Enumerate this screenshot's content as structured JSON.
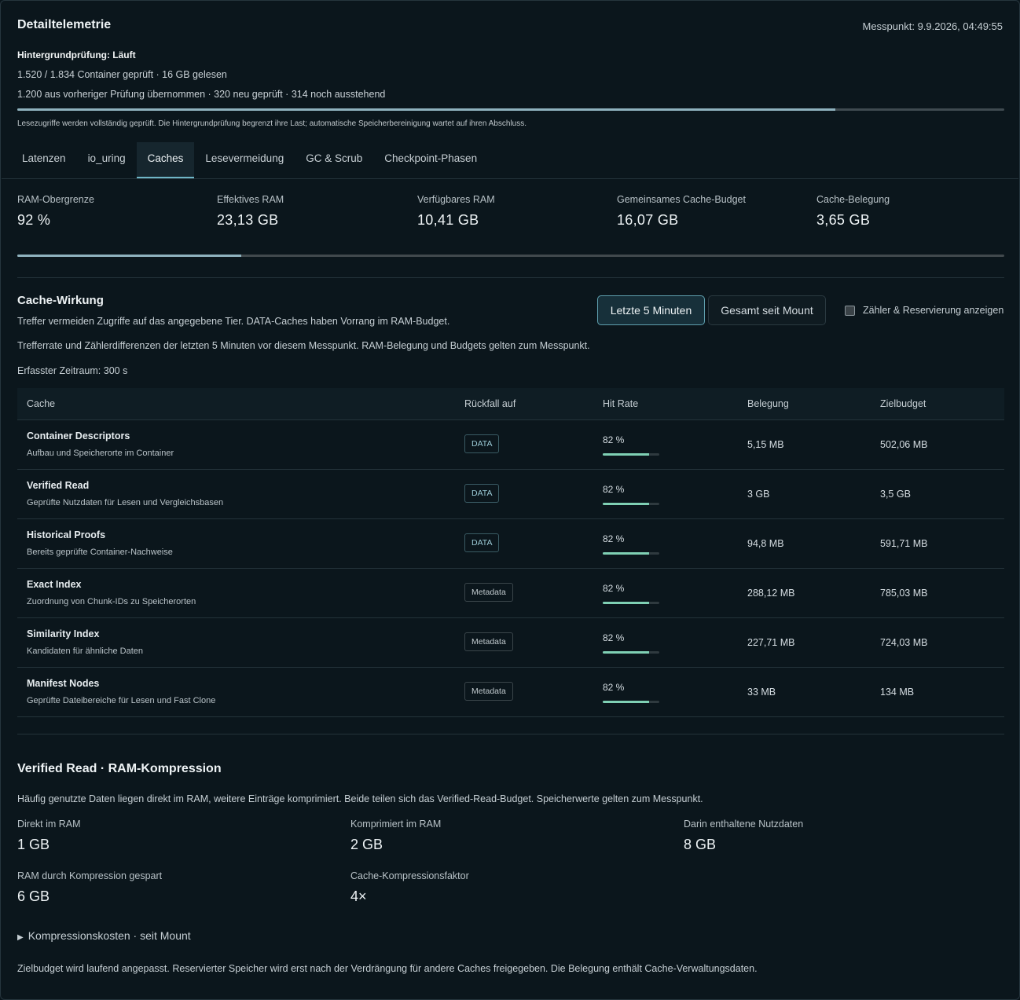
{
  "header": {
    "title": "Detailtelemetrie",
    "messpunkt": "Messpunkt: 9.9.2026, 04:49:55"
  },
  "background_check": {
    "title": "Hintergrundprüfung: Läuft",
    "line1": "1.520 / 1.834 Container geprüft · 16 GB gelesen",
    "line2": "1.200 aus vorheriger Prüfung übernommen · 320 neu geprüft · 314 noch ausstehend",
    "progress_fraction": 0.829,
    "note": "Lesezugriffe werden vollständig geprüft. Die Hintergrundprüfung begrenzt ihre Last; automatische Speicherbereinigung wartet auf ihren Abschluss."
  },
  "tabs": [
    {
      "label": "Latenzen"
    },
    {
      "label": "io_uring"
    },
    {
      "label": "Caches"
    },
    {
      "label": "Lesevermeidung"
    },
    {
      "label": "GC & Scrub"
    },
    {
      "label": "Checkpoint-Phasen"
    }
  ],
  "active_tab": "Caches",
  "stats": [
    {
      "label": "RAM-Obergrenze",
      "value": "92 %"
    },
    {
      "label": "Effektives RAM",
      "value": "23,13 GB"
    },
    {
      "label": "Verfügbares RAM",
      "value": "10,41 GB"
    },
    {
      "label": "Gemeinsames Cache-Budget",
      "value": "16,07 GB"
    },
    {
      "label": "Cache-Belegung",
      "value": "3,65 GB"
    }
  ],
  "cache_usage_fraction": 0.227,
  "cache_effect": {
    "title": "Cache-Wirkung",
    "desc": "Treffer vermeiden Zugriffe auf das angegebene Tier. DATA-Caches haben Vorrang im RAM-Budget.",
    "desc2": "Trefferrate und Zählerdifferenzen der letzten 5 Minuten vor diesem Messpunkt. RAM-Belegung und Budgets gelten zum Messpunkt.",
    "period": "Erfasster Zeitraum: 300 s",
    "btn_recent": "Letzte 5 Minuten",
    "btn_total": "Gesamt seit Mount",
    "checkbox_label": "Zähler & Reservierung anzeigen"
  },
  "table": {
    "headers": [
      "Cache",
      "Rückfall auf",
      "Hit Rate",
      "Belegung",
      "Zielbudget"
    ],
    "rows": [
      {
        "name": "Container Descriptors",
        "desc": "Aufbau und Speicherorte im Container",
        "fallback": "DATA",
        "type": "data",
        "hit": "82 %",
        "hit_fraction": 0.82,
        "belegung": "5,15 MB",
        "ziel": "502,06 MB"
      },
      {
        "name": "Verified Read",
        "desc": "Geprüfte Nutzdaten für Lesen und Vergleichsbasen",
        "fallback": "DATA",
        "type": "data",
        "hit": "82 %",
        "hit_fraction": 0.82,
        "belegung": "3 GB",
        "ziel": "3,5 GB"
      },
      {
        "name": "Historical Proofs",
        "desc": "Bereits geprüfte Container-Nachweise",
        "fallback": "DATA",
        "type": "data",
        "hit": "82 %",
        "hit_fraction": 0.82,
        "belegung": "94,8 MB",
        "ziel": "591,71 MB"
      },
      {
        "name": "Exact Index",
        "desc": "Zuordnung von Chunk-IDs zu Speicherorten",
        "fallback": "Metadata",
        "type": "meta",
        "hit": "82 %",
        "hit_fraction": 0.82,
        "belegung": "288,12 MB",
        "ziel": "785,03 MB"
      },
      {
        "name": "Similarity Index",
        "desc": "Kandidaten für ähnliche Daten",
        "fallback": "Metadata",
        "type": "meta",
        "hit": "82 %",
        "hit_fraction": 0.82,
        "belegung": "227,71 MB",
        "ziel": "724,03 MB"
      },
      {
        "name": "Manifest Nodes",
        "desc": "Geprüfte Dateibereiche für Lesen und Fast Clone",
        "fallback": "Metadata",
        "type": "meta",
        "hit": "82 %",
        "hit_fraction": 0.82,
        "belegung": "33 MB",
        "ziel": "134 MB"
      }
    ]
  },
  "compression": {
    "title": "Verified Read · RAM-Kompression",
    "desc": "Häufig genutzte Daten liegen direkt im RAM, weitere Einträge komprimiert. Beide teilen sich das Verified-Read-Budget. Speicherwerte gelten zum Messpunkt.",
    "items": [
      {
        "label": "Direkt im RAM",
        "value": "1 GB"
      },
      {
        "label": "Komprimiert im RAM",
        "value": "2 GB"
      },
      {
        "label": "Darin enthaltene Nutzdaten",
        "value": "8 GB"
      },
      {
        "label": "RAM durch Kompression gespart",
        "value": "6 GB"
      },
      {
        "label": "Cache-Kompressionsfaktor",
        "value": "4×"
      }
    ],
    "details_label": "Kompressionskosten · seit Mount",
    "footer": "Zielbudget wird laufend angepasst. Reservierter Speicher wird erst nach der Verdrängung für andere Caches freigegeben. Die Belegung enthält Cache-Verwaltungsdaten."
  }
}
